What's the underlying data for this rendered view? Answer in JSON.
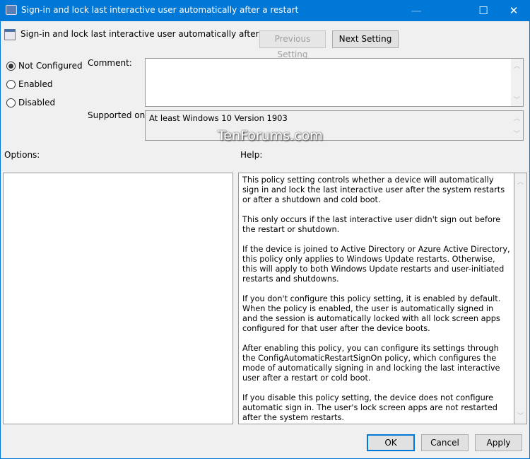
{
  "window": {
    "title": "Sign-in and lock last interactive user automatically after a restart",
    "minimize": "—",
    "maximize": "☐",
    "close": "✕"
  },
  "header": {
    "policy_name": "Sign-in and lock last interactive user automatically after a restart",
    "previous_label": "Previous Setting",
    "next_label": "Next Setting"
  },
  "state": {
    "options": [
      {
        "label": "Not Configured",
        "selected": true
      },
      {
        "label": "Enabled",
        "selected": false
      },
      {
        "label": "Disabled",
        "selected": false
      }
    ]
  },
  "comment": {
    "label": "Comment:",
    "value": ""
  },
  "supported": {
    "label": "Supported on:",
    "value": "At least Windows 10 Version 1903"
  },
  "watermark": "TenForums.com",
  "options_label": "Options:",
  "help_label": "Help:",
  "help": [
    "This policy setting controls whether a device will automatically sign in and lock the last interactive user after the system restarts or after a shutdown and cold boot.",
    "This only occurs if the last interactive user didn't sign out before the restart or shutdown.",
    "If the device is joined to Active Directory or Azure Active Directory, this policy only applies to Windows Update restarts. Otherwise, this will apply to both Windows Update restarts and user-initiated restarts and shutdowns.",
    "If you don't configure this policy setting, it is enabled by default. When the policy is enabled, the user is automatically signed in and the session is automatically locked with all lock screen apps configured for that user after the device boots.",
    "After enabling this policy, you can configure its settings through the ConfigAutomaticRestartSignOn policy, which configures the mode of automatically signing in and locking the last interactive user after a restart or cold boot.",
    "If you disable this policy setting, the device does not configure automatic sign in. The user's lock screen apps are not restarted after the system restarts."
  ],
  "footer": {
    "ok": "OK",
    "cancel": "Cancel",
    "apply": "Apply"
  }
}
